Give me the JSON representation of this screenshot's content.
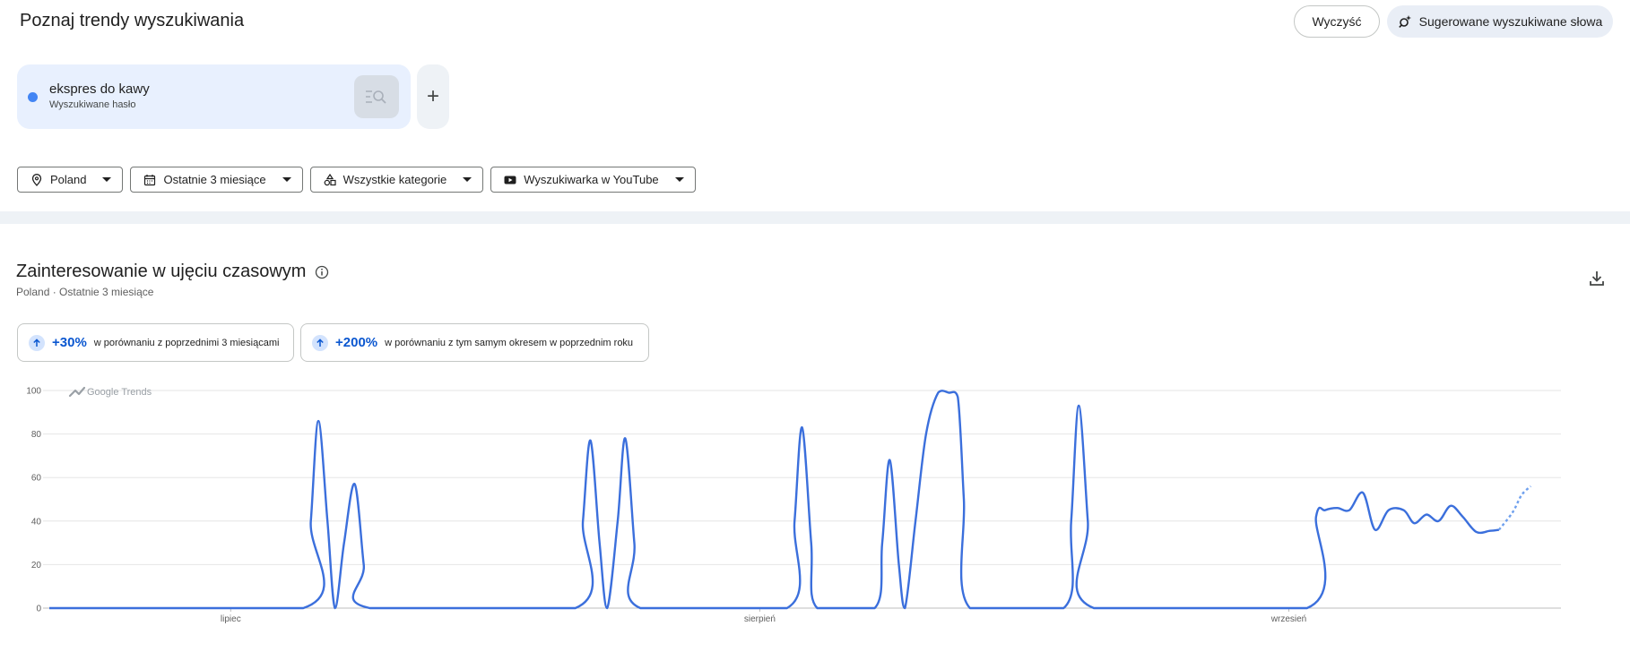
{
  "header": {
    "title": "Poznaj trendy wyszukiwania",
    "clear_label": "Wyczyść",
    "suggest_label": "Sugerowane wyszukiwane słowa"
  },
  "term": {
    "text": "ekspres do kawy",
    "subtitle": "Wyszukiwane hasło",
    "color": "#4285f4",
    "add_label": "+"
  },
  "filters": [
    {
      "label": "Poland",
      "icon": "location-pin-icon"
    },
    {
      "label": "Ostatnie 3 miesiące",
      "icon": "calendar-icon"
    },
    {
      "label": "Wszystkie kategorie",
      "icon": "category-icon"
    },
    {
      "label": "Wyszukiwarka w YouTube",
      "icon": "youtube-icon"
    }
  ],
  "section": {
    "title": "Zainteresowanie w ujęciu czasowym",
    "subtitle": "Poland · Ostatnie 3 miesiące"
  },
  "stats": [
    {
      "value": "+30%",
      "text": "w porównaniu z poprzednimi 3 miesiącami"
    },
    {
      "value": "+200%",
      "text": "w porównaniu z tym samym okresem w poprzednim roku"
    }
  ],
  "watermark": "Google Trends",
  "chart_data": {
    "type": "line",
    "ylim": [
      0,
      100
    ],
    "yticks": [
      0,
      20,
      40,
      60,
      80,
      100
    ],
    "xtick_labels": [
      {
        "label": "lipiec",
        "x": 12
      },
      {
        "label": "sierpień",
        "x": 47
      },
      {
        "label": "wrzesień",
        "x": 82
      }
    ],
    "x_range": [
      0,
      100
    ],
    "series": [
      {
        "color": "#3b6fdc",
        "points": [
          [
            0,
            0
          ],
          [
            16.8,
            0
          ],
          [
            17.3,
            40
          ],
          [
            17.8,
            86
          ],
          [
            18.4,
            40
          ],
          [
            18.9,
            0
          ],
          [
            19.5,
            30
          ],
          [
            20.2,
            57
          ],
          [
            20.8,
            20
          ],
          [
            21.2,
            0
          ],
          [
            34.8,
            0
          ],
          [
            35.3,
            40
          ],
          [
            35.8,
            77
          ],
          [
            36.4,
            30
          ],
          [
            36.9,
            0
          ],
          [
            37.6,
            40
          ],
          [
            38.1,
            78
          ],
          [
            38.7,
            30
          ],
          [
            39.1,
            0
          ],
          [
            48.8,
            0
          ],
          [
            49.3,
            40
          ],
          [
            49.8,
            83
          ],
          [
            50.4,
            30
          ],
          [
            50.8,
            0
          ],
          [
            54.6,
            0
          ],
          [
            55.1,
            30
          ],
          [
            55.6,
            68
          ],
          [
            56.2,
            20
          ],
          [
            56.6,
            0
          ],
          [
            57.3,
            40
          ],
          [
            58.0,
            80
          ],
          [
            58.8,
            99
          ],
          [
            59.5,
            99
          ],
          [
            60.1,
            97
          ],
          [
            60.5,
            50
          ],
          [
            60.9,
            0
          ],
          [
            67.1,
            0
          ],
          [
            67.6,
            40
          ],
          [
            68.1,
            93
          ],
          [
            68.7,
            40
          ],
          [
            69.1,
            0
          ],
          [
            83.2,
            0
          ],
          [
            83.8,
            42
          ],
          [
            84.4,
            45
          ],
          [
            85.2,
            46
          ],
          [
            86.0,
            45
          ],
          [
            86.9,
            53
          ],
          [
            87.7,
            36
          ],
          [
            88.6,
            45
          ],
          [
            89.6,
            45
          ],
          [
            90.3,
            39
          ],
          [
            91.1,
            43
          ],
          [
            91.9,
            40
          ],
          [
            92.7,
            47
          ],
          [
            93.5,
            42
          ],
          [
            94.4,
            35
          ],
          [
            95.3,
            35.5
          ],
          [
            95.9,
            36
          ]
        ],
        "partial": [
          [
            95.9,
            36
          ],
          [
            96.8,
            44
          ],
          [
            97.4,
            52
          ],
          [
            98.0,
            56
          ]
        ]
      }
    ]
  }
}
